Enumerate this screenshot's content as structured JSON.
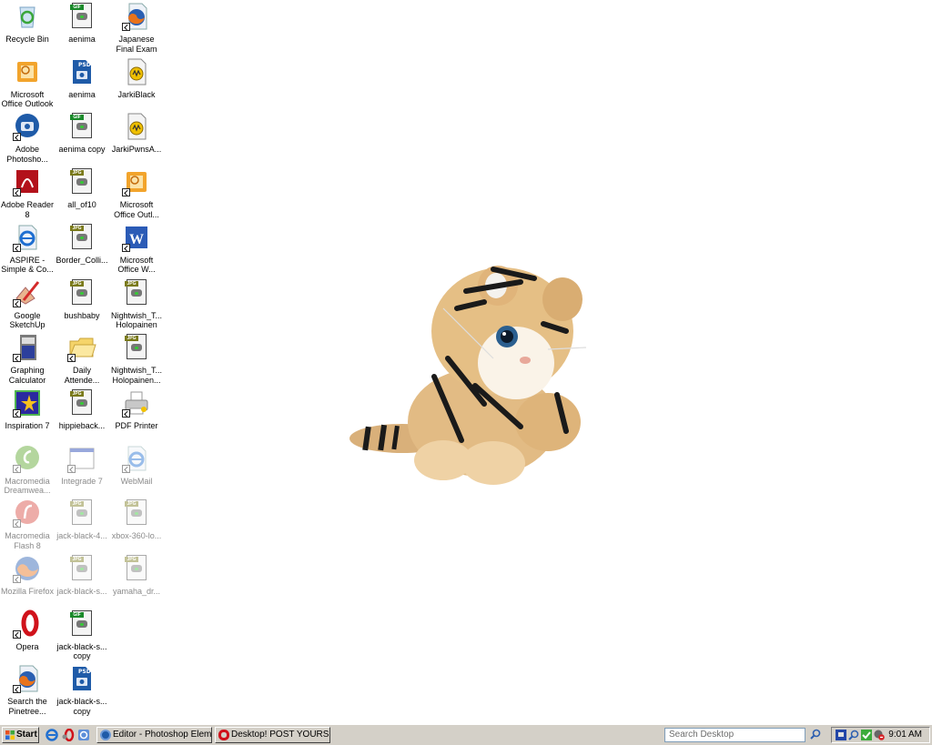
{
  "desktop": {
    "icons": [
      {
        "label": "Recycle Bin",
        "type": "recycle-bin",
        "dim": false
      },
      {
        "label": "Microsoft Office Outlook",
        "type": "outlook",
        "dim": false
      },
      {
        "label": "Adobe Photosho...",
        "type": "photoshop",
        "dim": false,
        "shortcut": true
      },
      {
        "label": "Adobe Reader 8",
        "type": "adobe-reader",
        "dim": false,
        "shortcut": true
      },
      {
        "label": "ASPIRE - Simple & Co...",
        "type": "ie-doc",
        "dim": false,
        "shortcut": true
      },
      {
        "label": "Google SketchUp",
        "type": "sketchup",
        "dim": false,
        "shortcut": true
      },
      {
        "label": "Graphing Calculator",
        "type": "calculator",
        "dim": false,
        "shortcut": true
      },
      {
        "label": "Inspiration 7",
        "type": "inspiration",
        "dim": false,
        "shortcut": true
      },
      {
        "label": "Macromedia Dreamwea...",
        "type": "dreamweaver",
        "dim": true,
        "shortcut": true
      },
      {
        "label": "Macromedia Flash 8",
        "type": "flash",
        "dim": true,
        "shortcut": true
      },
      {
        "label": "Mozilla Firefox",
        "type": "firefox",
        "dim": true,
        "shortcut": true
      },
      {
        "label": "Opera",
        "type": "opera",
        "dim": false,
        "shortcut": true
      },
      {
        "label": "Search the Pinetree...",
        "type": "firefox-doc",
        "dim": false,
        "shortcut": true
      },
      {
        "label": "aenima",
        "type": "gif",
        "dim": false
      },
      {
        "label": "aenima",
        "type": "psd",
        "dim": false
      },
      {
        "label": "aenima copy",
        "type": "gif",
        "dim": false
      },
      {
        "label": "all_of10",
        "type": "jpg",
        "dim": false
      },
      {
        "label": "Border_Colli...",
        "type": "jpg",
        "dim": false
      },
      {
        "label": "bushbaby",
        "type": "jpg",
        "dim": false
      },
      {
        "label": "Daily Attende...",
        "type": "folder",
        "dim": false,
        "shortcut": true
      },
      {
        "label": "hippieback...",
        "type": "jpg",
        "dim": false
      },
      {
        "label": "Integrade 7",
        "type": "window",
        "dim": true,
        "shortcut": true
      },
      {
        "label": "jack-black-4...",
        "type": "jpg",
        "dim": true
      },
      {
        "label": "jack-black-s...",
        "type": "jpg",
        "dim": true
      },
      {
        "label": "jack-black-s... copy",
        "type": "gif",
        "dim": false
      },
      {
        "label": "jack-black-s... copy",
        "type": "psd",
        "dim": false
      },
      {
        "label": "Japanese Final Exam",
        "type": "firefox-doc",
        "dim": false,
        "shortcut": true
      },
      {
        "label": "JarkiBlack",
        "type": "winamp",
        "dim": false
      },
      {
        "label": "JarkiPwnsA...",
        "type": "winamp",
        "dim": false
      },
      {
        "label": "Microsoft Office Outl...",
        "type": "outlook",
        "dim": false,
        "shortcut": true
      },
      {
        "label": "Microsoft Office W...",
        "type": "word",
        "dim": false,
        "shortcut": true
      },
      {
        "label": "Nightwish_T... Holopainen",
        "type": "jpg",
        "dim": false
      },
      {
        "label": "Nightwish_T... Holopainen...",
        "type": "jpg",
        "dim": false
      },
      {
        "label": "PDF Printer",
        "type": "printer",
        "dim": false,
        "shortcut": true
      },
      {
        "label": "WebMail",
        "type": "ie-doc",
        "dim": true,
        "shortcut": true
      },
      {
        "label": "xbox-360-lo...",
        "type": "jpg",
        "dim": true
      },
      {
        "label": "yamaha_dr...",
        "type": "jpg",
        "dim": true
      }
    ],
    "wallpaper_image": "stuffed-tiger-toy"
  },
  "taskbar": {
    "start_label": "Start",
    "quick_launch": [
      "internet-explorer",
      "opera",
      "outlook-express"
    ],
    "tasks": [
      {
        "label": "Editor - Photoshop Eleme...",
        "icon": "photoshop"
      },
      {
        "label": "Desktop! POST YOURS! -...",
        "icon": "opera"
      }
    ],
    "search_placeholder": "Search Desktop",
    "tray_icons": [
      "network-icon",
      "search-icon",
      "security-check-icon",
      "volume-muted-icon"
    ],
    "clock": "9:01 AM"
  }
}
